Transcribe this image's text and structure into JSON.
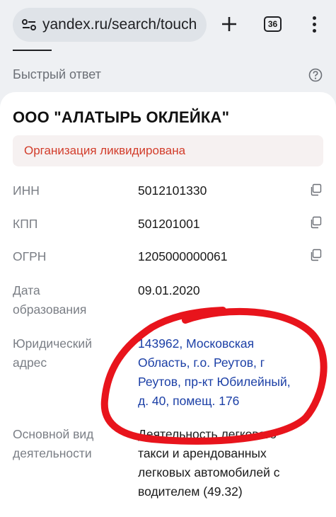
{
  "browser": {
    "url": "yandex.ru/search/touch",
    "tab_count": "36"
  },
  "quick_answer": {
    "title": "Быстрый ответ"
  },
  "company": {
    "name": "ООО \"АЛАТЫРЬ ОКЛЕЙКА\"",
    "status": "Организация ликвидирована",
    "fields": {
      "inn": {
        "label": "ИНН",
        "value": "5012101330"
      },
      "kpp": {
        "label": "КПП",
        "value": "501201001"
      },
      "ogrn": {
        "label": "ОГРН",
        "value": "1205000000061"
      },
      "founded": {
        "label_line1": "Дата",
        "label_line2": "образования",
        "value": "09.01.2020"
      },
      "address": {
        "label_line1": "Юридический",
        "label_line2": "адрес",
        "line1": "143962, Московская",
        "line2": "Область, г.о. Реутов, г",
        "line3": "Реутов, пр-кт Юбилейный,",
        "line4": "д. 40, помещ. 176"
      },
      "activity": {
        "label_line1": "Основной вид",
        "label_line2": "деятельности",
        "line1": "Деятельность легкового",
        "line2": "такси и арендованных",
        "line3": "легковых автомобилей с",
        "line4": "водителем (49.32)"
      }
    }
  },
  "colors": {
    "status_text": "#d23c2a",
    "link": "#1b3fa6",
    "annotation": "#e8141c"
  }
}
